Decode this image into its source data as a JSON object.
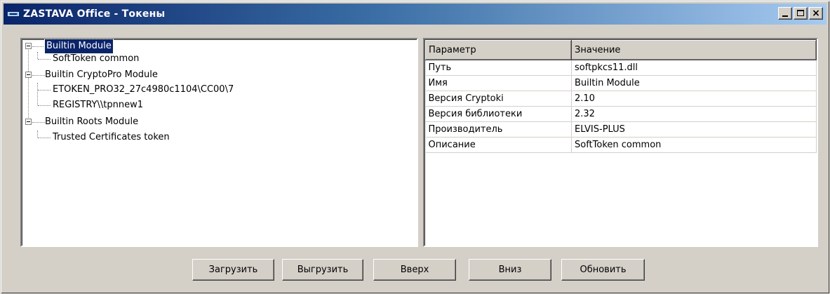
{
  "window": {
    "title": "ZASTAVA Office - Токены",
    "controls": {
      "minimize": "_",
      "close": "×"
    }
  },
  "tree": {
    "items": [
      {
        "label": "Builtin Module",
        "level": 0,
        "expanded": true,
        "selected": true
      },
      {
        "label": "SoftToken common",
        "level": 1
      },
      {
        "label": "Builtin CryptoPro Module",
        "level": 0,
        "expanded": true
      },
      {
        "label": "ETOKEN_PRO32_27c4980c1104\\CC00\\7",
        "level": 1
      },
      {
        "label": "REGISTRY\\\\tpnnew1",
        "level": 1
      },
      {
        "label": "Builtin Roots Module",
        "level": 0,
        "expanded": true
      },
      {
        "label": "Trusted Certificates token",
        "level": 1
      }
    ]
  },
  "grid": {
    "headers": {
      "param": "Параметр",
      "value": "Значение"
    },
    "rows": [
      {
        "param": "Путь",
        "value": "softpkcs11.dll"
      },
      {
        "param": "Имя",
        "value": "Builtin Module"
      },
      {
        "param": "Версия Cryptoki",
        "value": "2.10"
      },
      {
        "param": "Версия библиотеки",
        "value": "2.32"
      },
      {
        "param": "Производитель",
        "value": "ELVIS-PLUS"
      },
      {
        "param": "Описание",
        "value": "SoftToken common"
      }
    ]
  },
  "buttons": {
    "load": "Загрузить",
    "unload": "Выгрузить",
    "up": "Вверх",
    "down": "Вниз",
    "refresh": "Обновить"
  }
}
